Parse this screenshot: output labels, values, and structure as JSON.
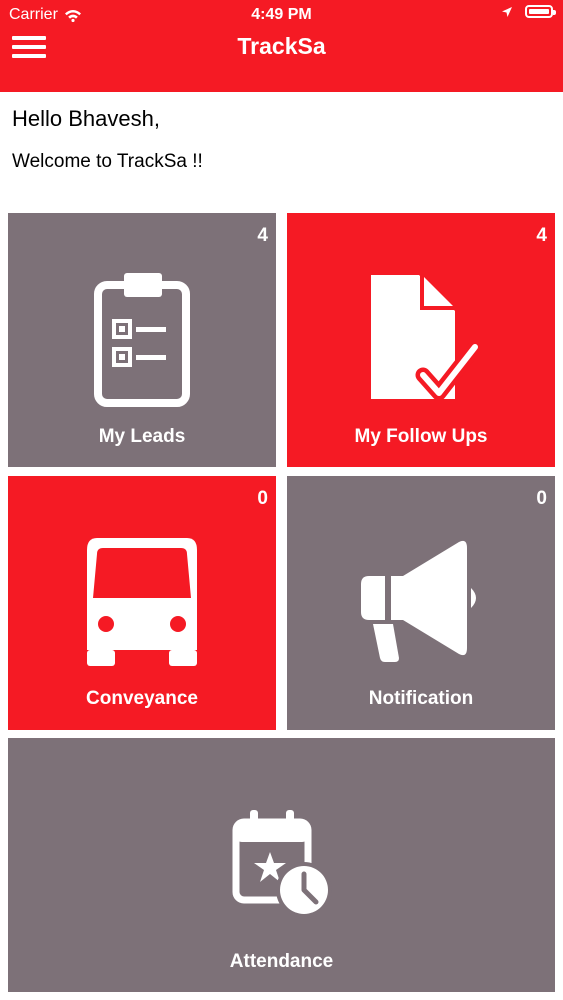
{
  "status_bar": {
    "carrier": "Carrier",
    "time": "4:49 PM"
  },
  "header": {
    "title": "TrackSa"
  },
  "greeting": {
    "hello": "Hello Bhavesh,",
    "welcome": "Welcome to TrackSa !!"
  },
  "tiles": [
    {
      "label": "My Leads",
      "count": "4",
      "icon": "clipboard-checklist-icon",
      "color": "#7d7178"
    },
    {
      "label": "My Follow Ups",
      "count": "4",
      "icon": "document-check-icon",
      "color": "#f51a24"
    },
    {
      "label": "Conveyance",
      "count": "0",
      "icon": "bus-icon",
      "color": "#f51a24"
    },
    {
      "label": "Notification",
      "count": "0",
      "icon": "megaphone-icon",
      "color": "#7d7178"
    },
    {
      "label": "Attendance",
      "icon": "calendar-clock-icon",
      "color": "#7d7178"
    }
  ],
  "colors": {
    "brand_red": "#f51a24",
    "tile_gray": "#7d7178"
  }
}
